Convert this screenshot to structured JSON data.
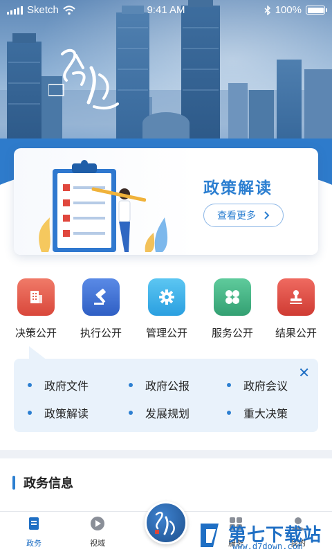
{
  "status_bar": {
    "carrier": "Sketch",
    "time": "9:41 AM",
    "battery": "100%"
  },
  "banner": {
    "title": "政策解读",
    "more_label": "查看更多"
  },
  "quick_actions": [
    {
      "label": "决策公开",
      "icon": "building-icon",
      "color": "#e4604f"
    },
    {
      "label": "执行公开",
      "icon": "gavel-icon",
      "color": "#3f72d6"
    },
    {
      "label": "管理公开",
      "icon": "gear-icon",
      "color": "#3aaee8"
    },
    {
      "label": "服务公开",
      "icon": "clover-icon",
      "color": "#45b486"
    },
    {
      "label": "结果公开",
      "icon": "stamp-icon",
      "color": "#de4a43"
    }
  ],
  "submenu": {
    "items": [
      "政府文件",
      "政府公报",
      "政府会议",
      "政策解读",
      "发展规划",
      "重大决策"
    ],
    "close_icon": "close-icon"
  },
  "section": {
    "title": "政务信息"
  },
  "tabbar": {
    "items": [
      {
        "label": "政务",
        "icon": "document-icon",
        "active": true
      },
      {
        "label": "视域",
        "icon": "play-icon",
        "active": false
      },
      {
        "label": "服务",
        "icon": "grid-icon",
        "active": false
      },
      {
        "label": "我的",
        "icon": "person-icon",
        "active": false
      }
    ]
  },
  "watermark": {
    "text": "第七下载站",
    "url": "www.d7down.com"
  },
  "colors": {
    "accent": "#2c7fd1",
    "submenu_bg": "#e9f2fb"
  }
}
